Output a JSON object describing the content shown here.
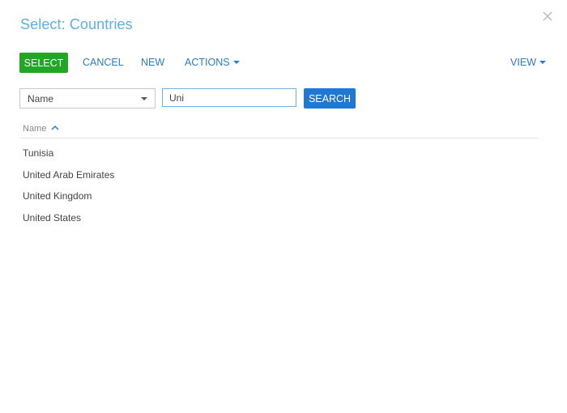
{
  "dialog": {
    "title": "Select: Countries"
  },
  "toolbar": {
    "select_label": "SELECT",
    "cancel_label": "CANCEL",
    "new_label": "NEW",
    "actions_label": "ACTIONS",
    "view_label": "VIEW"
  },
  "filter": {
    "column_selected": "Name",
    "search_value": "Uni",
    "search_button_label": "SEARCH"
  },
  "grid": {
    "columns": [
      {
        "label": "Name",
        "sort": "ascending"
      }
    ],
    "rows": [
      {
        "name": "Tunisia"
      },
      {
        "name": "United Arab Emirates"
      },
      {
        "name": "United Kingdom"
      },
      {
        "name": "United States"
      }
    ]
  },
  "colors": {
    "title": "#5db0e2",
    "select_button": "#23a625",
    "search_button": "#1f78d1",
    "link": "#2a7cc7"
  }
}
